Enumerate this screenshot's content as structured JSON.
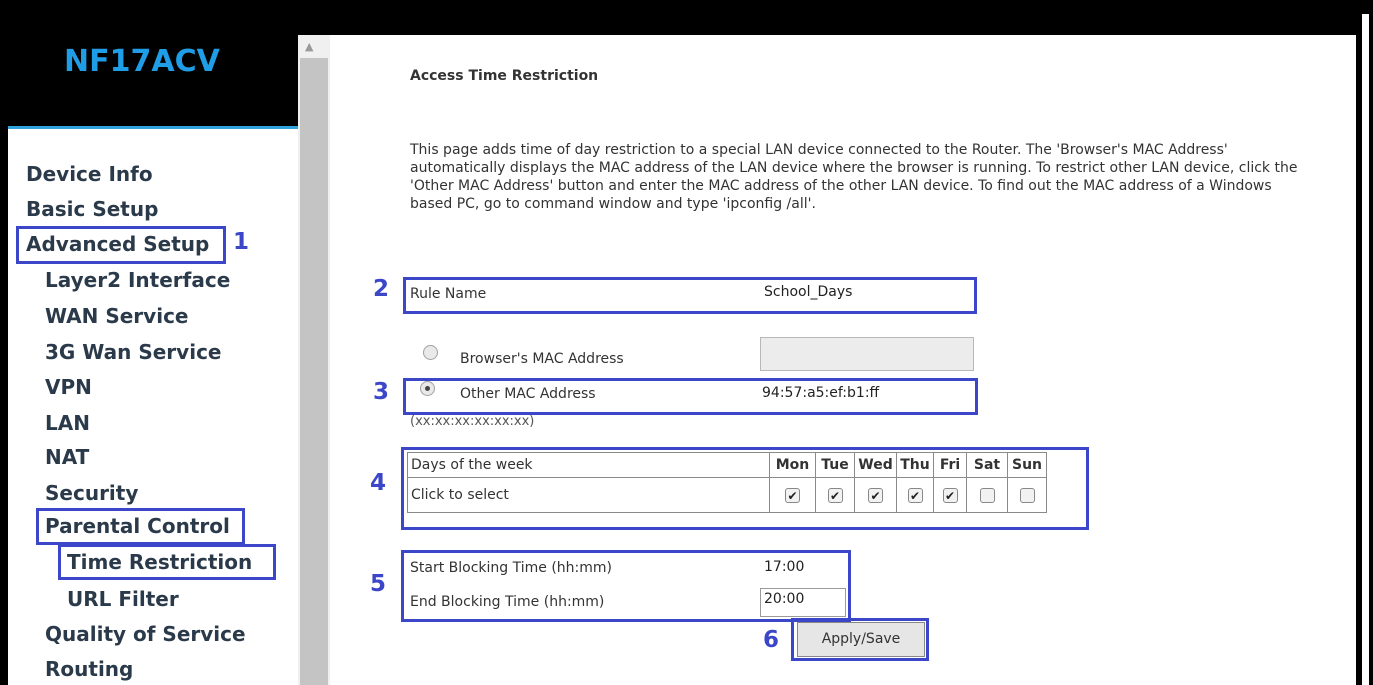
{
  "sidebar": {
    "logo": "NF17ACV",
    "items": [
      {
        "label": "Device Info"
      },
      {
        "label": "Basic Setup"
      },
      {
        "label": "Advanced Setup"
      },
      {
        "label": "Layer2 Interface"
      },
      {
        "label": "WAN Service"
      },
      {
        "label": "3G Wan Service"
      },
      {
        "label": "VPN"
      },
      {
        "label": "LAN"
      },
      {
        "label": "NAT"
      },
      {
        "label": "Security"
      },
      {
        "label": "Parental Control"
      },
      {
        "label": "Time Restriction"
      },
      {
        "label": "URL Filter"
      },
      {
        "label": "Quality of Service"
      },
      {
        "label": "Routing"
      }
    ]
  },
  "main": {
    "title": "Access Time Restriction",
    "description": "This page adds time of day restriction to a special LAN device connected to the Router. The 'Browser's MAC Address' automatically displays the MAC address of the LAN device where the browser is running. To restrict other LAN device, click the 'Other MAC Address' button and enter the MAC address of the other LAN device. To find out the MAC address of a Windows based PC, go to command window and type 'ipconfig /all'.",
    "rule_name_label": "Rule Name",
    "rule_name_value": "School_Days",
    "browser_mac_label": "Browser's MAC Address",
    "browser_mac_value": "",
    "other_mac_label": "Other MAC Address",
    "other_mac_value": "94:57:a5:ef:b1:ff",
    "mac_format_hint": "(xx:xx:xx:xx:xx:xx)",
    "selected_mac_option": "Other MAC Address",
    "days_header_label": "Days of the week",
    "days_select_label": "Click to select",
    "days": [
      {
        "name": "Mon",
        "checked": true
      },
      {
        "name": "Tue",
        "checked": true
      },
      {
        "name": "Wed",
        "checked": true
      },
      {
        "name": "Thu",
        "checked": true
      },
      {
        "name": "Fri",
        "checked": true
      },
      {
        "name": "Sat",
        "checked": false
      },
      {
        "name": "Sun",
        "checked": false
      }
    ],
    "start_label": "Start Blocking Time (hh:mm)",
    "start_value": "17:00",
    "end_label": "End Blocking Time (hh:mm)",
    "end_value": "20:00",
    "apply_button": "Apply/Save"
  },
  "callouts": [
    "1",
    "2",
    "3",
    "4",
    "5",
    "6"
  ],
  "colors": {
    "highlight": "#3b46c8",
    "logo": "#1f9de6",
    "nav_text": "#2b3a4a"
  }
}
